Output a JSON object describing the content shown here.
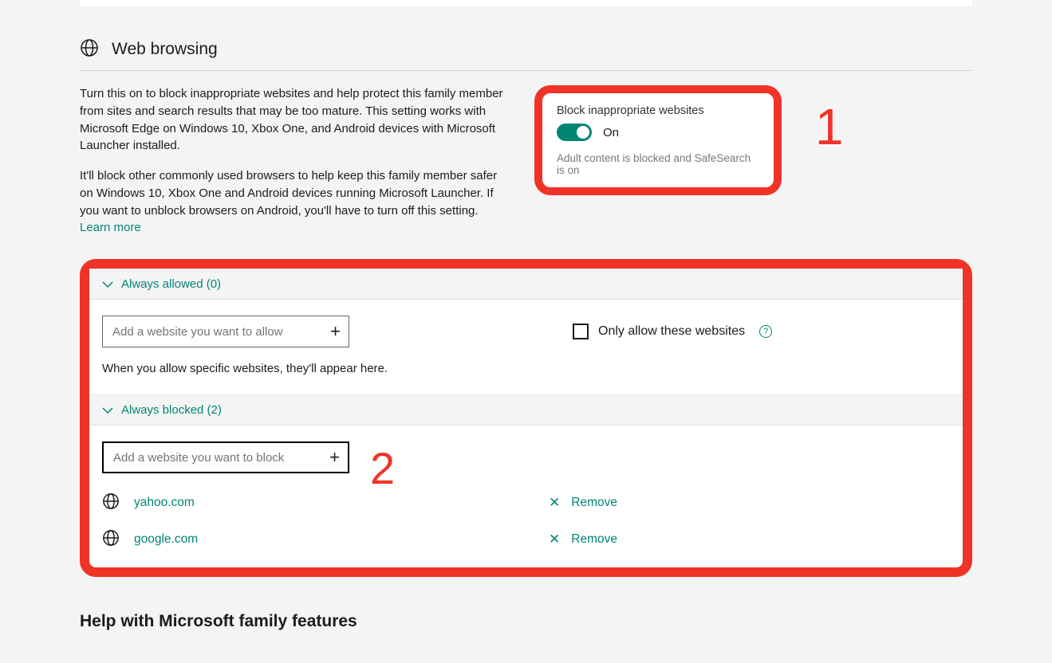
{
  "header": {
    "title": "Web browsing"
  },
  "intro": {
    "p1": "Turn this on to block inappropriate websites and help protect this family member from sites and search results that may be too mature. This setting works with Microsoft Edge on Windows 10, Xbox One, and Android devices with Microsoft Launcher installed.",
    "p2_a": "It'll block other commonly used browsers to help keep this family member safer on Windows 10, Xbox One and Android devices running Microsoft Launcher. If you want to unblock browsers on Android, you'll have to turn off this setting. ",
    "learn_more": "Learn more"
  },
  "block_card": {
    "title": "Block inappropriate websites",
    "state": "On",
    "desc": "Adult content is blocked and SafeSearch is on"
  },
  "annotations": {
    "one": "1",
    "two": "2"
  },
  "allowed": {
    "heading": "Always allowed (0)",
    "placeholder": "Add a website you want to allow",
    "only_allow": "Only allow these websites",
    "hint": "When you allow specific websites, they'll appear here."
  },
  "blocked": {
    "heading": "Always blocked (2)",
    "placeholder": "Add a website you want to block",
    "items": [
      {
        "url": "yahoo.com",
        "action": "Remove"
      },
      {
        "url": "google.com",
        "action": "Remove"
      }
    ]
  },
  "footer": {
    "help_heading": "Help with Microsoft family features"
  }
}
